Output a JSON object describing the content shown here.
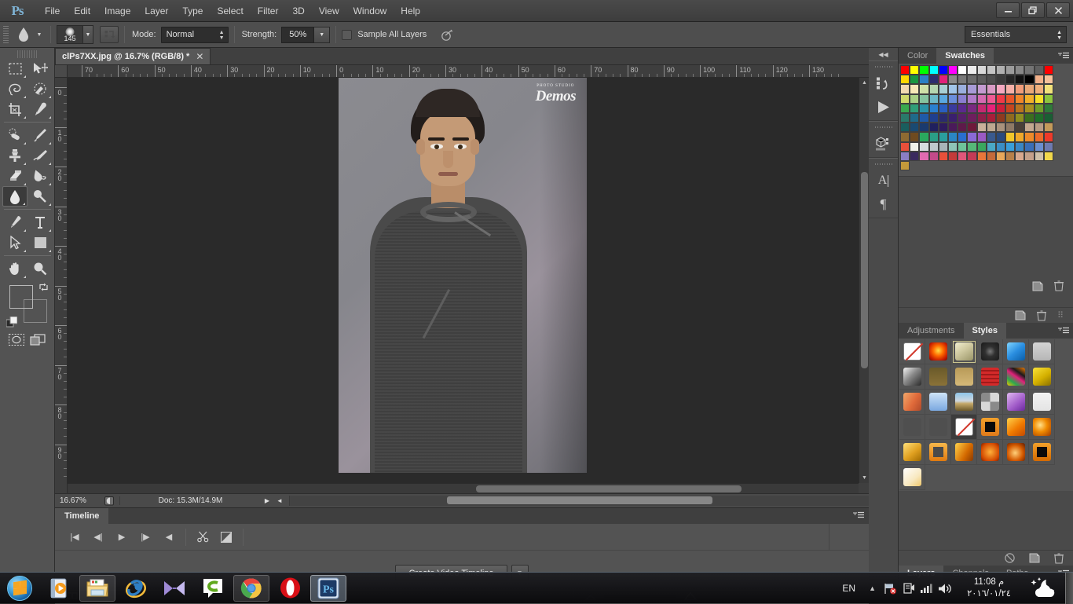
{
  "app": {
    "name": "Adobe Photoshop",
    "logo_text": "Ps"
  },
  "menubar": {
    "items": [
      {
        "label": "File"
      },
      {
        "label": "Edit"
      },
      {
        "label": "Image"
      },
      {
        "label": "Layer"
      },
      {
        "label": "Type"
      },
      {
        "label": "Select"
      },
      {
        "label": "Filter"
      },
      {
        "label": "3D"
      },
      {
        "label": "View"
      },
      {
        "label": "Window"
      },
      {
        "label": "Help"
      }
    ]
  },
  "window_controls": {
    "minimize": "—",
    "restore": "❐",
    "close": "✕"
  },
  "options_bar": {
    "tool": "smudge-tool",
    "brush_size": "145",
    "mode_label": "Mode:",
    "mode_value": "Normal",
    "strength_label": "Strength:",
    "strength_value": "50%",
    "sample_all_layers_label": "Sample All Layers",
    "sample_all_layers_checked": false,
    "workspace": "Essentials"
  },
  "toolbar": {
    "tools": [
      {
        "name": "rectangular-marquee-tool"
      },
      {
        "name": "move-tool"
      },
      {
        "name": "lasso-tool"
      },
      {
        "name": "quick-selection-tool"
      },
      {
        "name": "crop-tool"
      },
      {
        "name": "eyedropper-tool"
      },
      {
        "name": "spot-healing-brush-tool"
      },
      {
        "name": "brush-tool"
      },
      {
        "name": "clone-stamp-tool"
      },
      {
        "name": "history-brush-tool"
      },
      {
        "name": "eraser-tool"
      },
      {
        "name": "gradient-tool"
      },
      {
        "name": "smudge-tool"
      },
      {
        "name": "dodge-tool"
      },
      {
        "name": "pen-tool"
      },
      {
        "name": "horizontal-type-tool"
      },
      {
        "name": "path-selection-tool"
      },
      {
        "name": "rectangle-tool"
      },
      {
        "name": "hand-tool"
      },
      {
        "name": "zoom-tool"
      }
    ],
    "foreground_color": "#3dabe0",
    "background_color": "#ffffff",
    "edit_in_quick_mask": "quick-mask-mode",
    "screen_mode": "screen-mode"
  },
  "document": {
    "tab_title": "clPs7XX.jpg @ 16.7% (RGB/8) *",
    "close_glyph": "✕",
    "photo_logo_small": "PHOTO STUDIO",
    "photo_logo_big": "Demos",
    "ruler_h_labels": [
      "70",
      "60",
      "50",
      "40",
      "30",
      "20",
      "10",
      "0",
      "10",
      "20",
      "30",
      "40",
      "50",
      "60",
      "70",
      "80",
      "90",
      "100",
      "110",
      "120",
      "130"
    ],
    "ruler_v_labels": [
      "0",
      "10",
      "20",
      "30",
      "40",
      "50",
      "60",
      "70",
      "80",
      "90"
    ]
  },
  "status_bar": {
    "zoom": "16.67%",
    "doc_info": "Doc: 15.3M/14.9M",
    "play_glyph": "▶",
    "left_arrow_glyph": "◄"
  },
  "timeline": {
    "tab_label": "Timeline",
    "controls": [
      {
        "name": "go-to-first-frame-button",
        "glyph": "|◀"
      },
      {
        "name": "previous-frame-button",
        "glyph": "◀|"
      },
      {
        "name": "play-button",
        "glyph": "▶"
      },
      {
        "name": "next-frame-button",
        "glyph": "|▶"
      },
      {
        "name": "audio-mute-button",
        "glyph": "◀"
      }
    ],
    "split_label": "split-at-playhead",
    "transition_label": "transition",
    "create_button": "Create Video Timeline",
    "create_dropdown_glyph": "▼"
  },
  "icon_dock": {
    "collapse_glyph": "◀◀",
    "icons": [
      {
        "name": "history-panel-icon"
      },
      {
        "name": "actions-panel-icon"
      },
      {
        "name": "3d-panel-icon"
      },
      {
        "name": "character-panel-icon",
        "glyph": "A"
      },
      {
        "name": "paragraph-panel-icon",
        "glyph": "¶"
      }
    ]
  },
  "color_panel": {
    "tabs": [
      {
        "label": "Color",
        "active": false
      },
      {
        "label": "Swatches",
        "active": true
      }
    ],
    "menu_glyph": "▾☰",
    "swatches": [
      "#ff0000",
      "#ffff00",
      "#00ff00",
      "#00ffff",
      "#0000ff",
      "#ff00ff",
      "#ffffff",
      "#ececec",
      "#d8d8d8",
      "#c4c4c4",
      "#b0b0b0",
      "#9c9c9c",
      "#888888",
      "#747474",
      "#606060",
      "#ff0000",
      "#ffd700",
      "#1a9641",
      "#2b7fc4",
      "#2d2d6e",
      "#e0217a",
      "#8a8a8a",
      "#787878",
      "#6a6a6a",
      "#5c5c5c",
      "#4e4e4e",
      "#3a3a3a",
      "#262626",
      "#121212",
      "#000000",
      "#f0b08a",
      "#f4c09a",
      "#f2d9b0",
      "#f7e8b8",
      "#cfe0a8",
      "#b6d6b0",
      "#a8cfd4",
      "#a0c4e8",
      "#9aaedd",
      "#a79ad6",
      "#c39ad0",
      "#d89ac4",
      "#f4a8c0",
      "#f6b0a8",
      "#f09c7a",
      "#e8a878",
      "#eeb07c",
      "#f2e27a",
      "#cfd86a",
      "#a8cf86",
      "#86c4a0",
      "#6cb8c8",
      "#5aa8e0",
      "#6a8edc",
      "#8a7ed0",
      "#b07ac8",
      "#d46ab0",
      "#ee5a94",
      "#f03a48",
      "#e8562a",
      "#f0862a",
      "#f2b02a",
      "#f5e02a",
      "#8cc63e",
      "#3aa84e",
      "#2f9e78",
      "#2a93a8",
      "#2a7fd0",
      "#2a5ec0",
      "#3a3a9e",
      "#5a2a8e",
      "#7a2a80",
      "#c42a70",
      "#e8227a",
      "#cc1f3a",
      "#c4461f",
      "#b8721f",
      "#a8901f",
      "#6e9e2a",
      "#2f7a3a",
      "#2a7a6a",
      "#1f6a8a",
      "#1f5aa8",
      "#1f3f8e",
      "#2a2a6e",
      "#3a1f6e",
      "#56206a",
      "#6e1f5e",
      "#8e1f4a",
      "#a81f3a",
      "#8e3a1f",
      "#8e6a1f",
      "#8e8e1f",
      "#3a6e1f",
      "#1f6e2a",
      "#1a5e34",
      "#1a5e5e",
      "#1a4a72",
      "#1a3a6e",
      "#20205e",
      "#2e1a5e",
      "#4a1a5a",
      "#5e1a4a",
      "#6e1a3a",
      "#c9b09a",
      "#bda890",
      "#a8927c",
      "#8e7a66",
      "#4a4038",
      "#c4a890",
      "#b89c84",
      "#c49a5a",
      "#8e6a32",
      "#6e4a20",
      "#2aa85e",
      "#2a9e86",
      "#2a9e9e",
      "#2a86c4",
      "#2a6ed0",
      "#8a6ad6",
      "#9a5ac4",
      "#3a5a8e",
      "#2a4a7e",
      "#f2c62a",
      "#f0a82a",
      "#ee8a2a",
      "#ec6a2a",
      "#ee3a2a",
      "#e8503a",
      "#f2f2ea",
      "#d8dce0",
      "#c0c8cc",
      "#a8b4b8",
      "#8ec4b8",
      "#6ec49a",
      "#56b878",
      "#3aa85e",
      "#4aa8c4",
      "#3a8ec4",
      "#3a9ed8",
      "#3a86c4",
      "#3a6eb8",
      "#6a8ed0",
      "#6e7ab0",
      "#8a7ec4",
      "#3a2a5e",
      "#e06ab0",
      "#c44a8a",
      "#e8503a",
      "#c43a3a",
      "#e0567a",
      "#c43a56",
      "#e8763a",
      "#c46a3a",
      "#e8a85a",
      "#b8804a",
      "#d8a88e",
      "#c4a08a",
      "#cfc0a8",
      "#f2d84a",
      "#c49a3a"
    ]
  },
  "styles_panel": {
    "tabs": [
      {
        "label": "Adjustments",
        "active": false
      },
      {
        "label": "Styles",
        "active": true
      }
    ],
    "menu_glyph": "▾☰",
    "header_icons": [
      {
        "name": "new-style-icon"
      },
      {
        "name": "delete-style-icon"
      }
    ],
    "styles": [
      {
        "name": "default-none",
        "type": "none"
      },
      {
        "name": "red-glow",
        "type": "swatch",
        "color": "radial-gradient(circle at 50% 45%, #ffdd44 0%, #ff6a00 38%, #c41a00 75%, #6e0e00 100%)"
      },
      {
        "name": "outlined-bevel",
        "type": "swatch",
        "color": "linear-gradient(145deg,#f0eecf,#cfc9a0 45%,#9a9568)",
        "highlight": true
      },
      {
        "name": "dark-target",
        "type": "swatch",
        "color": "radial-gradient(circle at 50% 50%, #7a7a7a 0%, #303030 40%, #1a1a1a 100%)"
      },
      {
        "name": "blue-sky",
        "type": "swatch",
        "color": "linear-gradient(140deg,#7fd4ff 0%,#2a8ee0 50%,#0a5ea8 100%)"
      },
      {
        "name": "light-gray",
        "type": "swatch",
        "color": "linear-gradient(#d4d4d4,#b6b6b6)"
      },
      {
        "name": "gray-gradient",
        "type": "swatch",
        "color": "linear-gradient(135deg,#f4f4f4 0%,#8a8a8a 45%,#2a2a2a 100%)"
      },
      {
        "name": "olive-gradient",
        "type": "swatch",
        "color": "linear-gradient(#6a5a2a,#8a7238)"
      },
      {
        "name": "sand-gradient",
        "type": "swatch",
        "color": "linear-gradient(#b89a58,#d4b878)"
      },
      {
        "name": "red-plaid",
        "type": "swatch",
        "color": "repeating-linear-gradient(0deg,#d42a2a 0 3px,#a01a1a 3px 5px),repeating-linear-gradient(90deg,#d42a2a 0 3px,#a01a1a 3px 5px)"
      },
      {
        "name": "rainbow-abstract",
        "type": "swatch",
        "color": "linear-gradient(35deg,#f2c400 0%,#2aa84e 25%,#e0217a 50%,#1a1a1a 70%,#f27a00 100%)"
      },
      {
        "name": "yellow-bevel",
        "type": "swatch",
        "color": "linear-gradient(145deg,#f8e23a,#d4b000 55%,#8a7000)"
      },
      {
        "name": "sunset-gradient",
        "type": "swatch",
        "color": "linear-gradient(120deg,#f2a86a,#e06a3a 55%,#b04a2a)"
      },
      {
        "name": "sky-gradient",
        "type": "swatch",
        "color": "linear-gradient(#cfe4f8,#7aa8e0)"
      },
      {
        "name": "landscape",
        "type": "swatch",
        "color": "linear-gradient(#8ec4e8 0%,#cfd8e0 45%,#c4a86a 60%,#6e5a2a 100%)"
      },
      {
        "name": "noise-texture",
        "type": "swatch",
        "color": "repeating-conic-gradient(#d8d8d8 0 25%, #8a8a8a 0 50%)"
      },
      {
        "name": "purple-gradient",
        "type": "swatch",
        "color": "linear-gradient(140deg,#e0b8f0,#a05ac8 60%,#6a2a9e)"
      },
      {
        "name": "paper-fold",
        "type": "swatch",
        "color": "linear-gradient(#f2f2f2,#e4e4e4)"
      },
      {
        "name": "plain-outline",
        "type": "swatch",
        "color": "#4f4f4f"
      },
      {
        "name": "plain-outline-2",
        "type": "swatch",
        "color": "#4f4f4f"
      },
      {
        "name": "none-selected",
        "type": "none",
        "selected": true
      },
      {
        "name": "fire-black-center",
        "type": "swatch",
        "color": "linear-gradient(#f2a02a,#e07a1a)",
        "inner": "#0a0a0a"
      },
      {
        "name": "fire-gold",
        "type": "swatch",
        "color": "linear-gradient(140deg,#ffd24a,#f07a00 55%,#c44a00)"
      },
      {
        "name": "fire-burst",
        "type": "swatch",
        "color": "radial-gradient(circle at 40% 40%, #ffe08a 0%, #f08a00 45%, #a03a00 100%)"
      },
      {
        "name": "gold-emboss",
        "type": "swatch",
        "color": "linear-gradient(140deg,#ffe07a,#e0a020 55%,#a06a00)"
      },
      {
        "name": "fire-ring",
        "type": "swatch",
        "color": "linear-gradient(#f8b84a,#e07a10)",
        "inner": "#4a4a4a"
      },
      {
        "name": "molten-gold",
        "type": "swatch",
        "color": "linear-gradient(120deg,#ffd24a,#d46a00 60%,#8a3a00)"
      },
      {
        "name": "orange-glow",
        "type": "swatch",
        "color": "radial-gradient(circle,#ffb03a 0%,#d44a00 70%,#7a2200 100%)"
      },
      {
        "name": "ember",
        "type": "swatch",
        "color": "radial-gradient(circle at 45% 55%, #ffd07a 0%, #d45a00 55%, #5a1a00 100%)"
      },
      {
        "name": "fire-black-square",
        "type": "swatch",
        "color": "linear-gradient(#f2a02a,#d46a00)",
        "inner": "#0a0a0a"
      },
      {
        "name": "white-glow",
        "type": "swatch",
        "color": "linear-gradient(140deg,#ffffff,#f8e8c0 60%,#f0c86a)"
      }
    ]
  },
  "layers_panel": {
    "tabs": [
      {
        "label": "Layers",
        "active": true
      },
      {
        "label": "Channels",
        "active": false
      },
      {
        "label": "Paths",
        "active": false
      }
    ],
    "menu_glyph": "▾☰",
    "header_icons": [
      {
        "name": "no-entry-icon"
      },
      {
        "name": "new-layer-icon"
      },
      {
        "name": "delete-layer-icon"
      }
    ]
  },
  "taskbar": {
    "start_button": "start-orb",
    "apps": [
      {
        "name": "windows-media-player",
        "running": false
      },
      {
        "name": "file-explorer",
        "running": true
      },
      {
        "name": "internet-explorer",
        "running": false
      },
      {
        "name": "movie-maker",
        "running": false
      },
      {
        "name": "camtasia",
        "running": false
      },
      {
        "name": "google-chrome",
        "running": true
      },
      {
        "name": "opera-browser",
        "running": false
      },
      {
        "name": "adobe-photoshop",
        "running": true,
        "active": true
      }
    ],
    "language": "EN",
    "tray_arrow": "▲",
    "tray_icons": [
      {
        "name": "network-error-icon"
      },
      {
        "name": "action-center-icon"
      },
      {
        "name": "signal-strength-icon"
      },
      {
        "name": "volume-icon"
      }
    ],
    "time": "11:08 م",
    "date": "٢٠١٦/٠١/٢٤",
    "weather": "weather-night-cloud-icon"
  }
}
